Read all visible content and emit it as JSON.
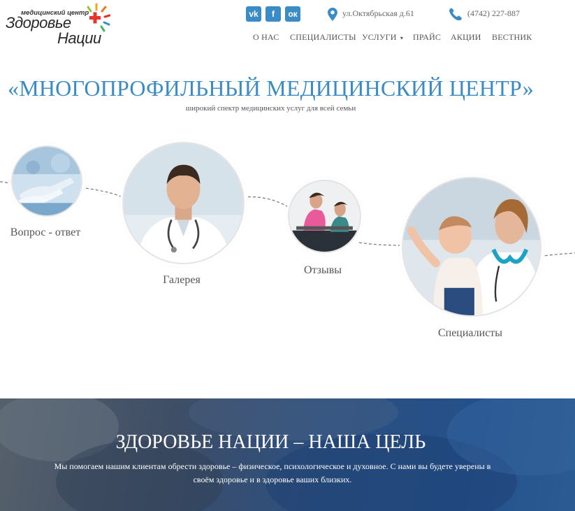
{
  "logo": {
    "small_text": "медицинский центр",
    "line1": "Здоровье",
    "line2": "Нации"
  },
  "social": [
    {
      "label": "vk",
      "icon": "vk-icon"
    },
    {
      "label": "f",
      "icon": "facebook-icon"
    },
    {
      "label": "ок",
      "icon": "odnoklassniki-icon"
    }
  ],
  "contacts": {
    "address": "ул.Октябрьская д.61",
    "phone": "(4742) 227-887"
  },
  "nav": {
    "items": [
      "О НАС",
      "СПЕЦИАЛИСТЫ",
      "УСЛУГИ",
      "ПРАЙС",
      "АКЦИИ",
      "ВЕСТНИК"
    ],
    "dropdown_caret": "▾"
  },
  "hero": {
    "title": "«МНОГОПРОФИЛЬНЫЙ МЕДИЦИНСКИЙ ЦЕНТР»",
    "subtitle": "широкий спектр медицинских услуг для всей семьи"
  },
  "sections": [
    {
      "label": "Вопрос - ответ",
      "image": "gloved-hands-photo"
    },
    {
      "label": "Галерея",
      "image": "doctor-portrait-photo"
    },
    {
      "label": "Отзывы",
      "image": "fitness-women-photo"
    },
    {
      "label": "Специалисты",
      "image": "nurse-with-baby-photo"
    }
  ],
  "banner": {
    "title": "ЗДОРОВЬЕ НАЦИИ – НАША ЦЕЛЬ",
    "text": "Мы помогаем нашим клиентам обрести здоровье – физическое, психологическое и духовное. С нами вы будете уверены в своём здоровье и в здоровье ваших близких."
  },
  "colors": {
    "accent": "#3b8cc4",
    "banner_blue": "#24508a",
    "logo_red": "#e8322c"
  }
}
